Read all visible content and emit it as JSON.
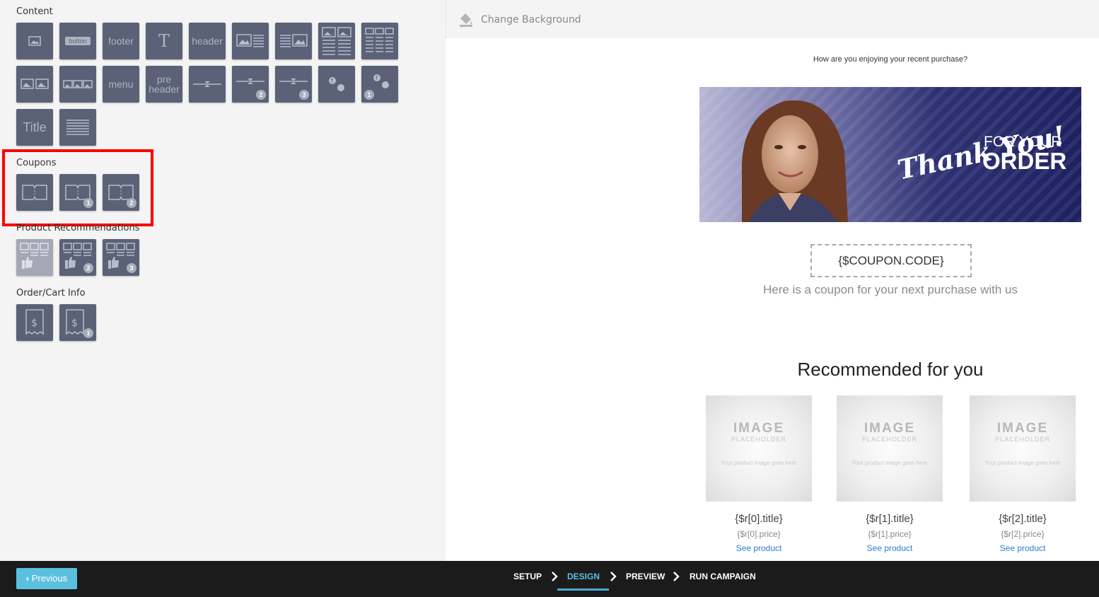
{
  "sidebar": {
    "content_title": "Content",
    "coupons_title": "Coupons",
    "recommendations_title": "Product Recommendations",
    "order_title": "Order/Cart Info",
    "tiles": {
      "button": "button",
      "footer": "footer",
      "text": "T",
      "header": "header",
      "menu": "menu",
      "preheader": "pre header",
      "title": "Title"
    },
    "badges": [
      "1",
      "2",
      "3"
    ]
  },
  "canvas": {
    "change_background": "Change Background",
    "preheader": "How are you enjoying your recent purchase?",
    "banner": {
      "script_text": "Thank You!",
      "for_your": "FOR YOUR",
      "order": "ORDER"
    },
    "coupon_code": "{$COUPON.CODE}",
    "coupon_text": "Here is a coupon for your next purchase with us",
    "recommended_title": "Recommended for you",
    "placeholder": {
      "big": "IMAGE",
      "mid": "PLACEHOLDER",
      "small": "Your product image goes here"
    },
    "products": [
      {
        "title": "{$r[0].title}",
        "price": "{$r[0].price}",
        "link": "See product"
      },
      {
        "title": "{$r[1].title}",
        "price": "{$r[1].price}",
        "link": "See product"
      },
      {
        "title": "{$r[2].title}",
        "price": "{$r[2].price}",
        "link": "See product"
      }
    ]
  },
  "footer": {
    "previous": "Previous",
    "steps": [
      "SETUP",
      "DESIGN",
      "PREVIEW",
      "RUN CAMPAIGN"
    ],
    "active_step": "DESIGN",
    "active_color": "#5bc0de"
  },
  "colors": {
    "tile": "#5b6177",
    "highlight": "#ff0000",
    "link": "#2f7bd1"
  }
}
